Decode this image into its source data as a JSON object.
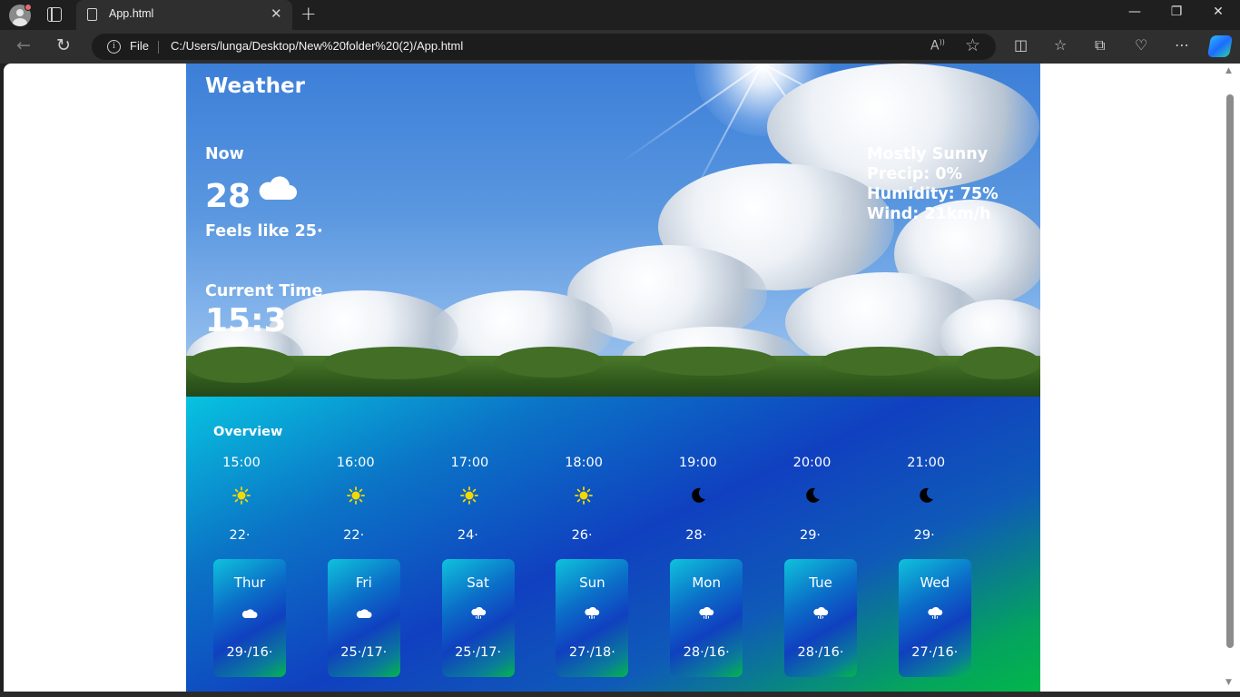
{
  "browser": {
    "tab_title": "App.html",
    "file_label": "File",
    "url": "C:/Users/lunga/Desktop/New%20folder%20(2)/App.html"
  },
  "weather": {
    "title": "Weather",
    "now_label": "Now",
    "now_temp": "28",
    "feels_like": "Feels like 25·",
    "current_time_label": "Current Time",
    "current_time": "15:3",
    "condition": "Mostly Sunny",
    "precip": "Precip: 0%",
    "humidity": "Humidity: 75%",
    "wind": "Wind: 21km/h"
  },
  "overview": {
    "title": "Overview",
    "hours": [
      {
        "time": "15:00",
        "icon": "sun-icon",
        "temp": "22·"
      },
      {
        "time": "16:00",
        "icon": "sun-icon",
        "temp": "22·"
      },
      {
        "time": "17:00",
        "icon": "sun-icon",
        "temp": "24·"
      },
      {
        "time": "18:00",
        "icon": "sun-icon",
        "temp": "26·"
      },
      {
        "time": "19:00",
        "icon": "moon-icon",
        "temp": "28·"
      },
      {
        "time": "20:00",
        "icon": "moon-icon",
        "temp": "29·"
      },
      {
        "time": "21:00",
        "icon": "moon-icon",
        "temp": "29·"
      }
    ],
    "days": [
      {
        "name": "Thur",
        "icon": "cloud-icon",
        "temp": "29·/16·"
      },
      {
        "name": "Fri",
        "icon": "cloud-icon",
        "temp": "25·/17·"
      },
      {
        "name": "Sat",
        "icon": "cloud-rain-icon",
        "temp": "25·/17·"
      },
      {
        "name": "Sun",
        "icon": "cloud-rain-icon",
        "temp": "27·/18·"
      },
      {
        "name": "Mon",
        "icon": "cloud-rain-icon",
        "temp": "28·/16·"
      },
      {
        "name": "Tue",
        "icon": "cloud-rain-icon",
        "temp": "28·/16·"
      },
      {
        "name": "Wed",
        "icon": "cloud-rain-icon",
        "temp": "27·/16·"
      }
    ]
  },
  "colors": {
    "sun": "#f5d800",
    "moon": "#000000",
    "overview_start": "#08c3e0",
    "overview_mid": "#1040c0",
    "overview_end": "#03b64a"
  }
}
